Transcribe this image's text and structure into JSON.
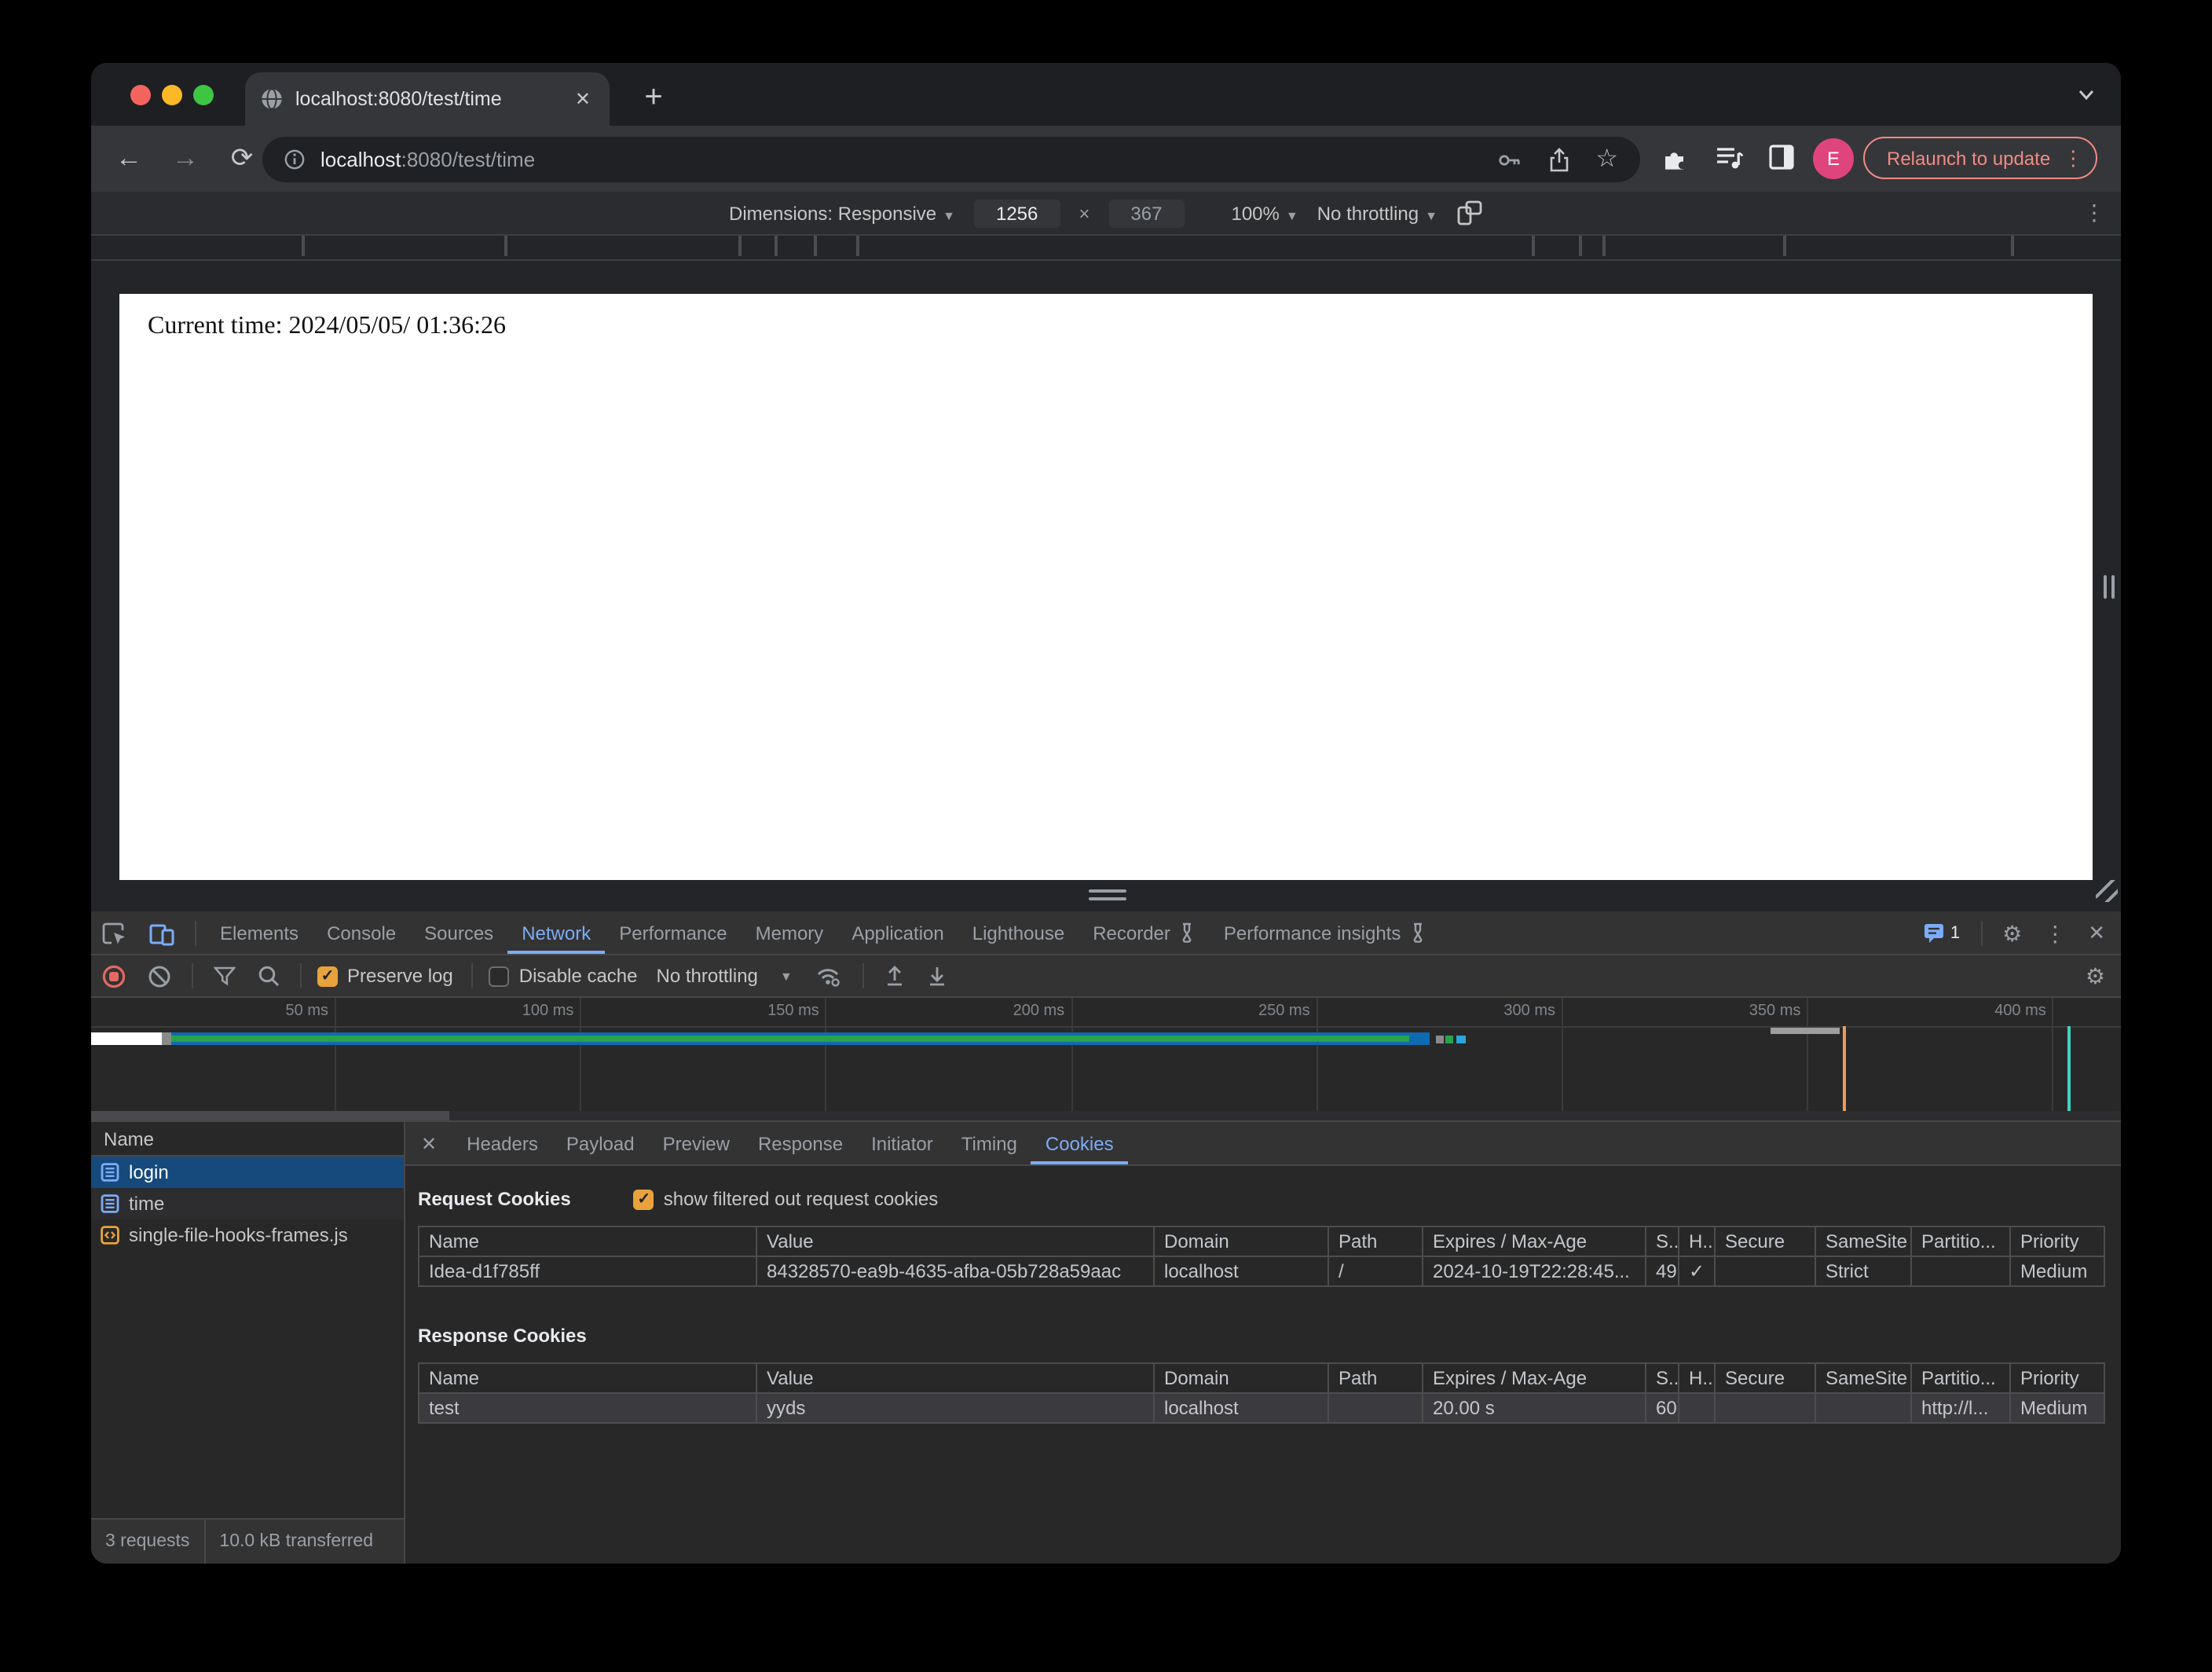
{
  "browser": {
    "tab_title": "localhost:8080/test/time",
    "url_host": "localhost",
    "url_rest": ":8080/test/time",
    "relaunch_label": "Relaunch to update",
    "avatar_letter": "E"
  },
  "device_toolbar": {
    "dimensions_label": "Dimensions: Responsive",
    "width_value": "1256",
    "times": "×",
    "height_value": "367",
    "zoom_value": "100%",
    "throttling_value": "No throttling"
  },
  "page": {
    "content": "Current time: 2024/05/05/ 01:36:26"
  },
  "devtools": {
    "tabs": [
      "Elements",
      "Console",
      "Sources",
      "Network",
      "Performance",
      "Memory",
      "Application",
      "Lighthouse",
      "Recorder",
      "Performance insights"
    ],
    "active_tab": "Network",
    "issues_count": "1",
    "network_toolbar": {
      "preserve_log": "Preserve log",
      "disable_cache": "Disable cache",
      "throttling": "No throttling"
    },
    "timeline_labels": [
      "50 ms",
      "100 ms",
      "150 ms",
      "200 ms",
      "250 ms",
      "300 ms",
      "350 ms",
      "400 ms"
    ],
    "requests": {
      "header": "Name",
      "items": [
        {
          "name": "login",
          "type": "document",
          "selected": true
        },
        {
          "name": "time",
          "type": "document",
          "selected": false
        },
        {
          "name": "single-file-hooks-frames.js",
          "type": "script",
          "selected": false
        }
      ]
    },
    "detail_tabs": [
      "Headers",
      "Payload",
      "Preview",
      "Response",
      "Initiator",
      "Timing",
      "Cookies"
    ],
    "active_detail_tab": "Cookies",
    "cookies": {
      "request_title": "Request Cookies",
      "filter_label": "show filtered out request cookies",
      "columns": [
        "Name",
        "Value",
        "Domain",
        "Path",
        "Expires / Max-Age",
        "S..",
        "H..",
        "Secure",
        "SameSite",
        "Partitio...",
        "Priority"
      ],
      "request_rows": [
        [
          "Idea-d1f785ff",
          "84328570-ea9b-4635-afba-05b728a59aac",
          "localhost",
          "/",
          "2024-10-19T22:28:45...",
          "49",
          "✓",
          "",
          "Strict",
          "",
          "Medium"
        ]
      ],
      "response_title": "Response Cookies",
      "response_rows": [
        [
          "test",
          "yyds",
          "localhost",
          "",
          "20.00 s",
          "60",
          "",
          "",
          "",
          "http://l...",
          "Medium"
        ]
      ]
    },
    "status_bar": {
      "requests": "3 requests",
      "transferred": "10.0 kB transferred"
    }
  },
  "colors": {
    "accent_blue": "#7cacf8",
    "selection_blue": "#164a7c",
    "checkbox_orange": "#e8a33d",
    "record_red": "#e46962",
    "bar_green": "#28a34b",
    "bar_blue": "#0f6ab0",
    "marker_orange": "#ef9958",
    "marker_teal": "#40d3c2",
    "relaunch_pink": "#f28b82",
    "avatar_pink": "#e0447c"
  }
}
